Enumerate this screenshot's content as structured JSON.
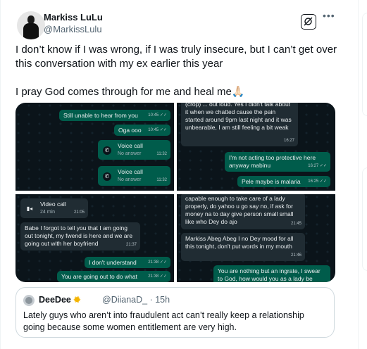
{
  "author": {
    "name": "Markiss LuLu",
    "handle": "@MarkissLulu"
  },
  "tweet": {
    "line1": "I don’t know if I was wrong, if I was truly insecure, but I can’t get over this conversation with my ex earlier this year",
    "line2": "I pray God comes through for me and heal me🙏🏻"
  },
  "chat1": {
    "msg1": "Still unable to hear from you",
    "msg1_time": "10:45 ✓✓",
    "msg2": "Oga ooo",
    "msg2_time": "10:45 ✓✓",
    "call1_title": "Voice call",
    "call1_sub": "No answer",
    "call1_time": "11:32",
    "call2_title": "Voice call",
    "call2_sub": "No answer",
    "call2_time": "11:32"
  },
  "chat2": {
    "msg1": "(crop) ... out loud. Yes I didn't talk about it when we chatted cause the pain started around 9pm last night and it was unbearable, I am still feeling a bit weak",
    "msg1_time": "16:27",
    "msg2": "I'm not acting too protective here anyway mabinu",
    "msg2_time": "16:27 ✓✓",
    "msg3": "Pele maybe is malaria",
    "msg3_time": "16:25 ✓✓"
  },
  "chat3": {
    "call_title": "Video call",
    "call_sub": "24 min",
    "call_time": "21:05",
    "msg1": "Babe I forgot to tell you that I am going out tonight, my fwend is here and we are going out with her boyfriend",
    "msg1_time": "21:37",
    "msg2": "I don't understand",
    "msg2_time": "21:38 ✓✓",
    "msg3": "You are going out to do what",
    "msg3_time": "21:38 ✓✓"
  },
  "chat4": {
    "msg1": "capable enough to take care of a lady properly, do yahoo u go say no, if ask for money na to day give person small small like who Dey do ajo",
    "msg1_time": "21:45",
    "msg2": "Markiss Abeg Abeg I no Dey mood for all this tonight, don't put words in my mouth",
    "msg2_time": "21:46",
    "msg3": "You are nothing but an ingrate, I swear to God, how would you as a lady be"
  },
  "quote": {
    "name": "DeeDee",
    "handle": "@DiianaD_ · 15h",
    "text": "Lately guys who aren’t into fraudulent act can’t really keep a relationship going because some women entitlement are very high."
  },
  "icons": {
    "grok": "grok-icon",
    "more": "more-icon",
    "verified": "sun-badge-icon"
  }
}
